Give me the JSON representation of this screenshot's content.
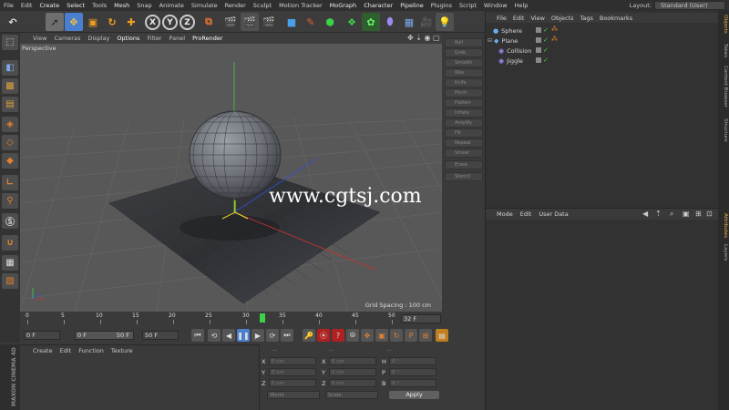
{
  "menubar": {
    "items": [
      "File",
      "Edit",
      "Create",
      "Select",
      "Tools",
      "Mesh",
      "Snap",
      "Animate",
      "Simulate",
      "Render",
      "Sculpt",
      "Motion Tracker",
      "MoGraph",
      "Character",
      "Pipeline",
      "Plugins",
      "Script",
      "Window",
      "Help"
    ],
    "layout_label": "Layout:",
    "layout_value": "Standard (User)"
  },
  "toolbar": {
    "axis_x": "X",
    "axis_y": "Y",
    "axis_z": "Z"
  },
  "viewport": {
    "menu": [
      "View",
      "Cameras",
      "Display",
      "Options",
      "Filter",
      "Panel",
      "ProRender"
    ],
    "active_menu": "Options",
    "label": "Perspective",
    "grid_spacing": "Grid Spacing : 100 cm",
    "watermark": "www.cgtsj.com"
  },
  "deformers": [
    "Roll",
    "Grab",
    "Smooth",
    "Wax",
    "Knife",
    "Pinch",
    "Flatten",
    "Inflate",
    "Amplify",
    "Fill",
    "Repeat",
    "Smear",
    "Erase",
    "Stencil"
  ],
  "timeline": {
    "ticks": [
      "0",
      "5",
      "10",
      "15",
      "20",
      "25",
      "30",
      "35",
      "40",
      "45",
      "50"
    ],
    "current_frame": "32 F"
  },
  "transport": {
    "start": "0 F",
    "range_start": "0 F",
    "range_end": "50 F",
    "end": "50 F"
  },
  "material": {
    "menu": [
      "Create",
      "Edit",
      "Function",
      "Texture"
    ]
  },
  "brand": "MAXON CINEMA 4D",
  "coordinates": {
    "header": [
      "--",
      "--",
      "--"
    ],
    "rows": [
      {
        "pl": "X",
        "pv": "0 cm",
        "sl": "X",
        "sv": "0 cm",
        "rl": "H",
        "rv": "0 °"
      },
      {
        "pl": "Y",
        "pv": "0 cm",
        "sl": "Y",
        "sv": "0 cm",
        "rl": "P",
        "rv": "0 °"
      },
      {
        "pl": "Z",
        "pv": "0 cm",
        "sl": "Z",
        "sv": "0 cm",
        "rl": "B",
        "rv": "0 °"
      }
    ],
    "world": "World",
    "scale": "Scale",
    "apply": "Apply"
  },
  "objects": {
    "menu": [
      "File",
      "Edit",
      "View",
      "Objects",
      "Tags",
      "Bookmarks"
    ],
    "items": [
      {
        "name": "Sphere",
        "indent": 0
      },
      {
        "name": "Plane",
        "indent": 0
      },
      {
        "name": "Collision",
        "indent": 1
      },
      {
        "name": "Jiggle",
        "indent": 1
      }
    ]
  },
  "attributes": {
    "menu": [
      "Mode",
      "Edit",
      "User Data"
    ]
  },
  "right_tabs": [
    "Objects",
    "Takes",
    "Content Browser",
    "Structure",
    "Attributes",
    "Layers"
  ],
  "colors": {
    "accent_green": "#3cd24a",
    "highlight_blue": "#4a7fd0",
    "active_tab": "#f0b040"
  }
}
